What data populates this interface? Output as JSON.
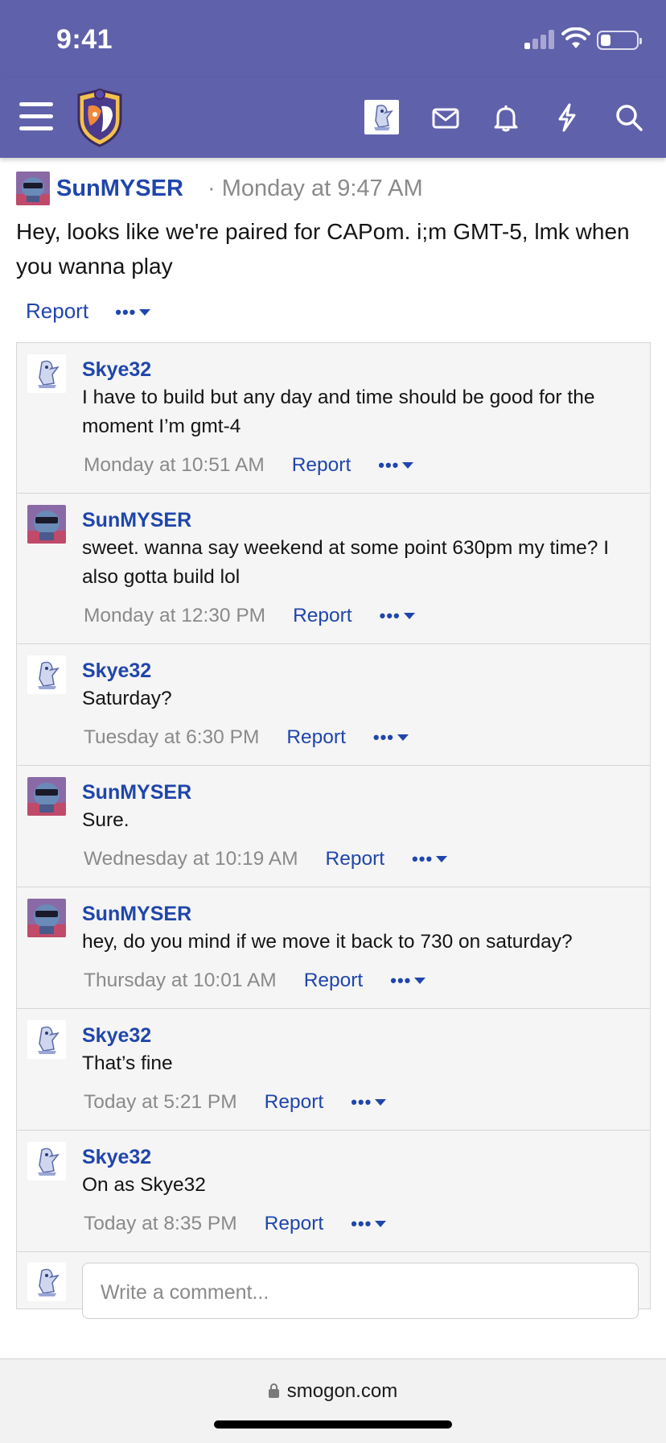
{
  "status_bar": {
    "time": "9:41",
    "battery_level": 0.25
  },
  "header": {
    "menu_icon": "hamburger-icon",
    "logo_icon": "smogon-logo",
    "icons": [
      "user-avatar",
      "mail-icon",
      "bell-icon",
      "bolt-icon",
      "search-icon"
    ]
  },
  "post": {
    "username": "SunMYSER",
    "separator": "·",
    "timestamp": "Monday at 9:47 AM",
    "text": "Hey, looks like we're paired for CAPom. i;m GMT-5, lmk when you wanna play",
    "report_label": "Report",
    "more_label": "•••"
  },
  "comments": [
    {
      "username": "Skye32",
      "text": "I have to build but any day and time should be good for the moment I’m gmt-4",
      "date": "Monday at 10:51 AM",
      "report": "Report",
      "more": "•••",
      "avatar": "skye"
    },
    {
      "username": "SunMYSER",
      "text": "sweet. wanna say weekend at some point 630pm my time? I also gotta build lol",
      "date": "Monday at 12:30 PM",
      "report": "Report",
      "more": "•••",
      "avatar": "sun"
    },
    {
      "username": "Skye32",
      "text": "Saturday?",
      "date": "Tuesday at 6:30 PM",
      "report": "Report",
      "more": "•••",
      "avatar": "skye"
    },
    {
      "username": "SunMYSER",
      "text": "Sure.",
      "date": "Wednesday at 10:19 AM",
      "report": "Report",
      "more": "•••",
      "avatar": "sun"
    },
    {
      "username": "SunMYSER",
      "text": "hey, do you mind if we move it back to 730 on saturday?",
      "date": "Thursday at 10:01 AM",
      "report": "Report",
      "more": "•••",
      "avatar": "sun"
    },
    {
      "username": "Skye32",
      "text": "That’s fine",
      "date": "Today at 5:21 PM",
      "report": "Report",
      "more": "•••",
      "avatar": "skye"
    },
    {
      "username": "Skye32",
      "text": "On as Skye32",
      "date": "Today at 8:35 PM",
      "report": "Report",
      "more": "•••",
      "avatar": "skye"
    }
  ],
  "composer": {
    "placeholder": "Write a comment..."
  },
  "browser": {
    "url": "smogon.com"
  },
  "colors": {
    "header": "#6061ab",
    "link": "#2046ab",
    "muted": "#8a8a8a",
    "panel": "#f5f5f5"
  }
}
